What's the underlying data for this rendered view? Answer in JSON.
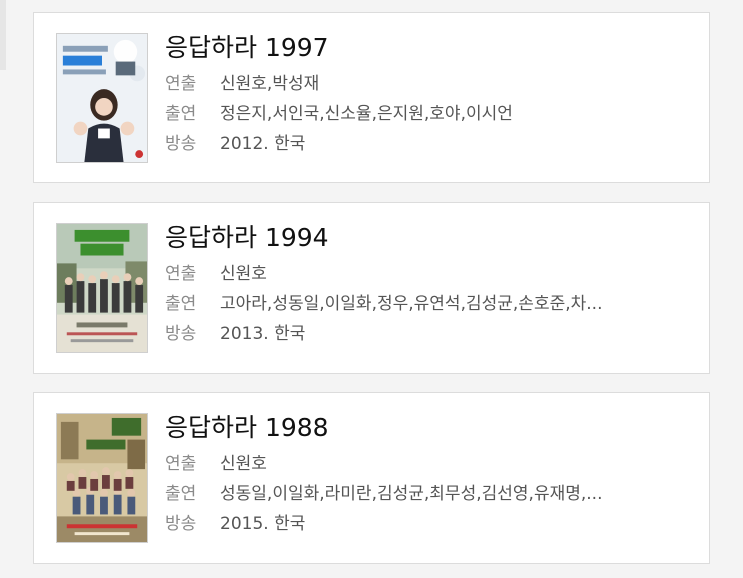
{
  "labels": {
    "director": "연출",
    "cast": "출연",
    "broadcast": "방송"
  },
  "items": [
    {
      "title": "응답하라 1997",
      "director": "신원호,박성재",
      "cast": "정은지,서인국,신소율,은지원,호야,이시언",
      "broadcast": "2012. 한국",
      "poster_colors": {
        "bg": "#eef2f6",
        "accent": "#2a7fd8"
      }
    },
    {
      "title": "응답하라 1994",
      "director": "신원호",
      "cast": "고아라,성동일,이일화,정우,유연석,김성균,손호준,차...",
      "broadcast": "2013. 한국",
      "poster_colors": {
        "bg": "#cfd8c7",
        "accent": "#3c8f2e"
      }
    },
    {
      "title": "응답하라 1988",
      "director": "신원호",
      "cast": "성동일,이일화,라미란,김성균,최무성,김선영,유재명,...",
      "broadcast": "2015. 한국",
      "poster_colors": {
        "bg": "#d8c9a4",
        "accent": "#3f6d2c"
      }
    }
  ]
}
